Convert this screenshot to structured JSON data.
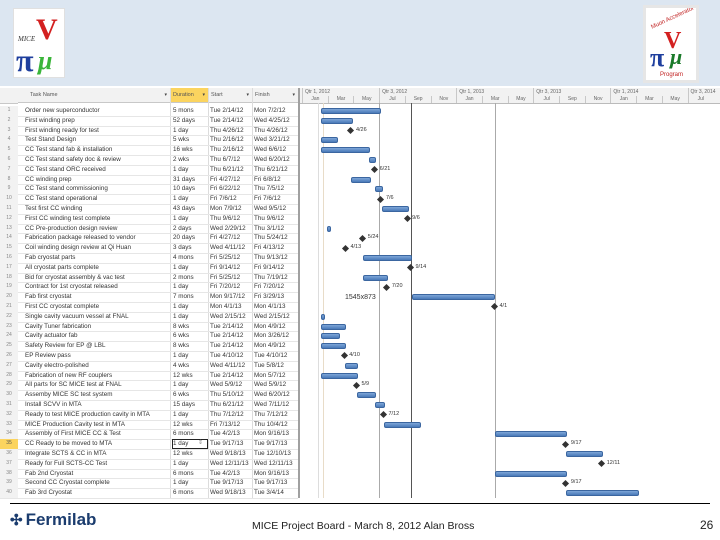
{
  "banner": {
    "left_logo": "MICE logo",
    "right_logo": "Muon Accelerator Program logo",
    "right_logo_text_top": "Muon Accelerator",
    "right_logo_text_bottom": "Program"
  },
  "table": {
    "columns": {
      "task_name": "Task Name",
      "duration": "Duration",
      "start": "Start",
      "finish": "Finish"
    },
    "sort_arrow": "▼",
    "selected_row": 35,
    "rows": [
      {
        "id": "1",
        "name": "Order new superconductor",
        "duration": "5 mons",
        "start": "Tue 2/14/12",
        "finish": "Mon 7/2/12"
      },
      {
        "id": "2",
        "name": "First winding prep",
        "duration": "52 days",
        "start": "Tue 2/14/12",
        "finish": "Wed 4/25/12"
      },
      {
        "id": "3",
        "name": "First winding ready for test",
        "duration": "1 day",
        "start": "Thu 4/26/12",
        "finish": "Thu 4/26/12"
      },
      {
        "id": "4",
        "name": "Test Stand Design",
        "duration": "5 wks",
        "start": "Thu 2/16/12",
        "finish": "Wed 3/21/12"
      },
      {
        "id": "5",
        "name": "CC Test stand fab & installation",
        "duration": "16 wks",
        "start": "Thu 2/16/12",
        "finish": "Wed 6/6/12"
      },
      {
        "id": "6",
        "name": "CC Test stand safety doc & review",
        "duration": "2 wks",
        "start": "Thu 6/7/12",
        "finish": "Wed 6/20/12"
      },
      {
        "id": "7",
        "name": "CC Test stand ORC received",
        "duration": "1 day",
        "start": "Thu 6/21/12",
        "finish": "Thu 6/21/12"
      },
      {
        "id": "8",
        "name": "CC winding prep",
        "duration": "31 days",
        "start": "Fri 4/27/12",
        "finish": "Fri 6/8/12"
      },
      {
        "id": "9",
        "name": "CC Test stand commissioning",
        "duration": "10 days",
        "start": "Fri 6/22/12",
        "finish": "Thu 7/5/12"
      },
      {
        "id": "10",
        "name": "CC Test stand operational",
        "duration": "1 day",
        "start": "Fri 7/6/12",
        "finish": "Fri 7/6/12"
      },
      {
        "id": "11",
        "name": "Test first CC winding",
        "duration": "43 days",
        "start": "Mon 7/9/12",
        "finish": "Wed 9/5/12"
      },
      {
        "id": "12",
        "name": "First CC winding test complete",
        "duration": "1 day",
        "start": "Thu 9/6/12",
        "finish": "Thu 9/6/12"
      },
      {
        "id": "13",
        "name": "CC Pre-production design review",
        "duration": "2 days",
        "start": "Wed 2/29/12",
        "finish": "Thu 3/1/12"
      },
      {
        "id": "14",
        "name": "Fabrication package released to vendor",
        "duration": "20 days",
        "start": "Fri 4/27/12",
        "finish": "Thu 5/24/12"
      },
      {
        "id": "15",
        "name": "Coil winding design review at Qi Huan",
        "duration": "3 days",
        "start": "Wed 4/11/12",
        "finish": "Fri 4/13/12"
      },
      {
        "id": "16",
        "name": "Fab cryostat parts",
        "duration": "4 mons",
        "start": "Fri 5/25/12",
        "finish": "Thu 9/13/12"
      },
      {
        "id": "17",
        "name": "All cryostat parts complete",
        "duration": "1 day",
        "start": "Fri 9/14/12",
        "finish": "Fri 9/14/12"
      },
      {
        "id": "18",
        "name": "Bid for cryostat assembly & vac test",
        "duration": "2 mons",
        "start": "Fri 5/25/12",
        "finish": "Thu 7/19/12"
      },
      {
        "id": "19",
        "name": "Contract for 1st cryostat released",
        "duration": "1 day",
        "start": "Fri 7/20/12",
        "finish": "Fri 7/20/12"
      },
      {
        "id": "20",
        "name": "Fab first cryostat",
        "duration": "7 mons",
        "start": "Mon 9/17/12",
        "finish": "Fri 3/29/13"
      },
      {
        "id": "21",
        "name": "First CC cryostat complete",
        "duration": "1 day",
        "start": "Mon 4/1/13",
        "finish": "Mon 4/1/13"
      },
      {
        "id": "22",
        "name": "Single cavity vacuum vessel at FNAL",
        "duration": "1 day",
        "start": "Wed 2/15/12",
        "finish": "Wed 2/15/12"
      },
      {
        "id": "23",
        "name": "Cavity Tuner fabrication",
        "duration": "8 wks",
        "start": "Tue 2/14/12",
        "finish": "Mon 4/9/12"
      },
      {
        "id": "24",
        "name": "Cavity actuator fab",
        "duration": "6 wks",
        "start": "Tue 2/14/12",
        "finish": "Mon 3/26/12"
      },
      {
        "id": "25",
        "name": "Safety Review for EP @ LBL",
        "duration": "8 wks",
        "start": "Tue 2/14/12",
        "finish": "Mon 4/9/12"
      },
      {
        "id": "26",
        "name": "EP Review pass",
        "duration": "1 day",
        "start": "Tue 4/10/12",
        "finish": "Tue 4/10/12"
      },
      {
        "id": "27",
        "name": "Cavity electro-polished",
        "duration": "4 wks",
        "start": "Wed 4/11/12",
        "finish": "Tue 5/8/12"
      },
      {
        "id": "28",
        "name": "Fabrication of new RF couplers",
        "duration": "12 wks",
        "start": "Tue 2/14/12",
        "finish": "Mon 5/7/12"
      },
      {
        "id": "29",
        "name": "All parts for SC MICE test at FNAL",
        "duration": "1 day",
        "start": "Wed 5/9/12",
        "finish": "Wed 5/9/12"
      },
      {
        "id": "30",
        "name": "Assemby MICE SC test system",
        "duration": "6 wks",
        "start": "Thu 5/10/12",
        "finish": "Wed 6/20/12"
      },
      {
        "id": "31",
        "name": "Install SCVV in MTA",
        "duration": "15 days",
        "start": "Thu 6/21/12",
        "finish": "Wed 7/11/12"
      },
      {
        "id": "32",
        "name": "Ready to test MICE production cavity in MTA",
        "duration": "1 day",
        "start": "Thu 7/12/12",
        "finish": "Thu 7/12/12"
      },
      {
        "id": "33",
        "name": "MICE Production Cavity test in MTA",
        "duration": "12 wks",
        "start": "Fri 7/13/12",
        "finish": "Thu 10/4/12"
      },
      {
        "id": "34",
        "name": "Assembly of First MICE CC & Test",
        "duration": "6 mons",
        "start": "Tue 4/2/13",
        "finish": "Mon 9/16/13"
      },
      {
        "id": "35",
        "name": "CC Ready to be moved to MTA",
        "duration": "1 day",
        "start": "Tue 9/17/13",
        "finish": "Tue 9/17/13"
      },
      {
        "id": "36",
        "name": "Integrate SCTS & CC in MTA",
        "duration": "12 wks",
        "start": "Wed 9/18/13",
        "finish": "Tue 12/10/13"
      },
      {
        "id": "37",
        "name": "Ready for Full SCTS-CC Test",
        "duration": "1 day",
        "start": "Wed 12/11/13",
        "finish": "Wed 12/11/13"
      },
      {
        "id": "38",
        "name": "Fab 2nd Cryostat",
        "duration": "6 mons",
        "start": "Tue 4/2/13",
        "finish": "Mon 9/16/13"
      },
      {
        "id": "39",
        "name": "Second CC Cryostat complete",
        "duration": "1 day",
        "start": "Tue 9/17/13",
        "finish": "Tue 9/17/13"
      },
      {
        "id": "40",
        "name": "Fab 3rd Cryostat",
        "duration": "6 mons",
        "start": "Wed 9/18/13",
        "finish": "Tue 3/4/14"
      }
    ]
  },
  "timeline": {
    "quarters": [
      "Qtr 1, 2012",
      "Qtr 3, 2012",
      "Qtr 1, 2013",
      "Qtr 3, 2013",
      "Qtr 1, 2014",
      "Qtr 3, 2014"
    ],
    "months": [
      "Jan",
      "Mar",
      "May",
      "Jul",
      "Sep",
      "Nov",
      "Jan",
      "Mar",
      "May",
      "Jul",
      "Sep",
      "Nov",
      "Jan",
      "Mar",
      "May",
      "Jul"
    ],
    "start": "2012-01-01"
  },
  "gantt": {
    "tasks": [
      {
        "row": 1,
        "type": "bar",
        "start": "2012-02-14",
        "finish": "2012-07-02"
      },
      {
        "row": 2,
        "type": "bar",
        "start": "2012-02-14",
        "finish": "2012-04-25"
      },
      {
        "row": 3,
        "type": "milestone",
        "date": "2012-04-26",
        "label": "4/26"
      },
      {
        "row": 4,
        "type": "bar",
        "start": "2012-02-16",
        "finish": "2012-03-21"
      },
      {
        "row": 5,
        "type": "bar",
        "start": "2012-02-16",
        "finish": "2012-06-06"
      },
      {
        "row": 6,
        "type": "bar",
        "start": "2012-06-07",
        "finish": "2012-06-20"
      },
      {
        "row": 7,
        "type": "milestone",
        "date": "2012-06-21",
        "label": "6/21"
      },
      {
        "row": 8,
        "type": "bar",
        "start": "2012-04-27",
        "finish": "2012-06-08"
      },
      {
        "row": 9,
        "type": "bar",
        "start": "2012-06-22",
        "finish": "2012-07-05"
      },
      {
        "row": 10,
        "type": "milestone",
        "date": "2012-07-06",
        "label": "7/6"
      },
      {
        "row": 11,
        "type": "bar",
        "start": "2012-07-09",
        "finish": "2012-09-05"
      },
      {
        "row": 12,
        "type": "milestone",
        "date": "2012-09-06",
        "label": "9/6"
      },
      {
        "row": 13,
        "type": "bar",
        "start": "2012-02-29",
        "finish": "2012-03-01"
      },
      {
        "row": 14,
        "type": "milestone",
        "date": "2012-05-24",
        "label": "5/24"
      },
      {
        "row": 15,
        "type": "milestone",
        "date": "2012-04-13",
        "label": "4/13"
      },
      {
        "row": 16,
        "type": "bar",
        "start": "2012-05-25",
        "finish": "2012-09-13"
      },
      {
        "row": 17,
        "type": "milestone",
        "date": "2012-09-14",
        "label": "9/14"
      },
      {
        "row": 18,
        "type": "bar",
        "start": "2012-05-25",
        "finish": "2012-07-19"
      },
      {
        "row": 19,
        "type": "milestone",
        "date": "2012-07-20",
        "label": "7/20"
      },
      {
        "row": 20,
        "type": "bar",
        "start": "2012-09-17",
        "finish": "2013-03-29"
      },
      {
        "row": 21,
        "type": "milestone",
        "date": "2013-04-01",
        "label": "4/1"
      },
      {
        "row": 22,
        "type": "bar",
        "start": "2012-02-15",
        "finish": "2012-02-16"
      },
      {
        "row": 23,
        "type": "bar",
        "start": "2012-02-14",
        "finish": "2012-04-09"
      },
      {
        "row": 24,
        "type": "bar",
        "start": "2012-02-14",
        "finish": "2012-03-26"
      },
      {
        "row": 25,
        "type": "bar",
        "start": "2012-02-14",
        "finish": "2012-04-09"
      },
      {
        "row": 26,
        "type": "milestone",
        "date": "2012-04-10",
        "label": "4/10"
      },
      {
        "row": 27,
        "type": "bar",
        "start": "2012-04-11",
        "finish": "2012-05-08"
      },
      {
        "row": 28,
        "type": "bar",
        "start": "2012-02-14",
        "finish": "2012-05-07"
      },
      {
        "row": 29,
        "type": "milestone",
        "date": "2012-05-09",
        "label": "5/9"
      },
      {
        "row": 30,
        "type": "bar",
        "start": "2012-05-10",
        "finish": "2012-06-20"
      },
      {
        "row": 31,
        "type": "bar",
        "start": "2012-06-21",
        "finish": "2012-07-11"
      },
      {
        "row": 32,
        "type": "milestone",
        "date": "2012-07-12",
        "label": "7/12"
      },
      {
        "row": 33,
        "type": "bar",
        "start": "2012-07-13",
        "finish": "2012-10-04"
      },
      {
        "row": 34,
        "type": "bar",
        "start": "2013-04-02",
        "finish": "2013-09-16"
      },
      {
        "row": 35,
        "type": "milestone",
        "date": "2013-09-17",
        "label": "9/17"
      },
      {
        "row": 36,
        "type": "bar",
        "start": "2013-09-18",
        "finish": "2013-12-10"
      },
      {
        "row": 37,
        "type": "milestone",
        "date": "2013-12-11",
        "label": "12/11"
      },
      {
        "row": 38,
        "type": "bar",
        "start": "2013-04-02",
        "finish": "2013-09-16"
      },
      {
        "row": 39,
        "type": "milestone",
        "date": "2013-09-17",
        "label": "9/17"
      },
      {
        "row": 40,
        "type": "bar",
        "start": "2013-09-18",
        "finish": "2014-03-04"
      }
    ],
    "size_readout": "1545x873"
  },
  "footer": {
    "brand": "Fermilab",
    "title": "MICE Project Board - March 8, 2012   Alan Bross",
    "page": "26"
  }
}
